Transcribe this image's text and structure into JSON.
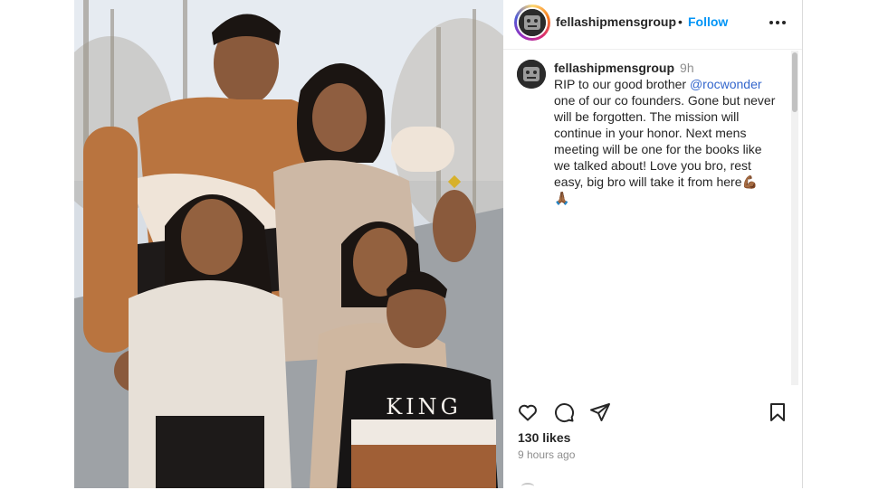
{
  "post": {
    "username": "fellashipmensgroup",
    "separator": "•",
    "follow_label": "Follow",
    "more_icon": "more-horizontal-icon"
  },
  "caption": {
    "username": "fellashipmensgroup",
    "time": "9h",
    "text_before_mention": "RIP to our good brother ",
    "mention": "@rocwonder",
    "text_after_mention": " one of our co founders. Gone but never will be forgotten. The mission will continue in your honor. Next mens meeting will be one for the books like we talked about! Love you bro, rest easy, big bro will take it from here",
    "emoji_1": "💪🏾",
    "emoji_2": "🙏🏾"
  },
  "photo": {
    "sweater_text": "KING"
  },
  "actions": {
    "like_icon": "heart-icon",
    "comment_icon": "comment-icon",
    "share_icon": "paper-plane-icon",
    "save_icon": "bookmark-icon"
  },
  "stats": {
    "likes": "130 likes",
    "posted": "9 hours ago"
  },
  "colors": {
    "accent_link": "#0095f6",
    "mention": "#3366cc",
    "muted": "#8e8e8e"
  }
}
